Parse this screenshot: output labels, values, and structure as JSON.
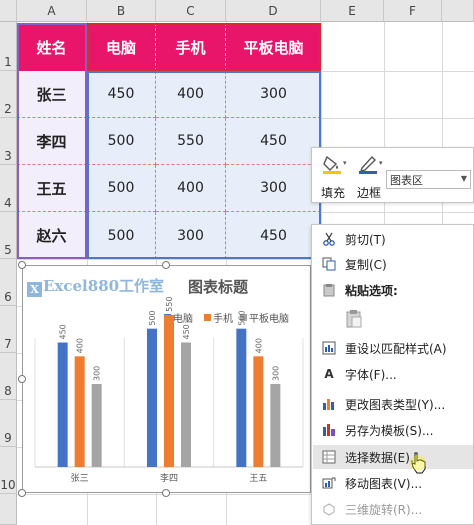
{
  "columns": [
    "A",
    "B",
    "C",
    "D",
    "E",
    "F"
  ],
  "rows": [
    "1",
    "2",
    "3",
    "4",
    "5",
    "6",
    "7",
    "8",
    "9",
    "10"
  ],
  "table": {
    "headers": [
      "姓名",
      "电脑",
      "手机",
      "平板电脑"
    ],
    "rows": [
      {
        "name": "张三",
        "values": [
          "450",
          "400",
          "300"
        ]
      },
      {
        "name": "李四",
        "values": [
          "500",
          "550",
          "450"
        ]
      },
      {
        "name": "王五",
        "values": [
          "500",
          "400",
          "300"
        ]
      },
      {
        "name": "赵六",
        "values": [
          "500",
          "300",
          "450"
        ]
      }
    ]
  },
  "chart": {
    "watermark": "Excel880工作室",
    "watermark_icon": "x-logo-icon"
  },
  "chart_data": {
    "type": "bar",
    "title": "图表标题",
    "categories": [
      "张三",
      "李四",
      "王五"
    ],
    "series": [
      {
        "name": "电脑",
        "values": [
          450,
          500,
          500
        ],
        "color": "#4472c4"
      },
      {
        "name": "手机",
        "values": [
          400,
          550,
          400
        ],
        "color": "#ed7d31"
      },
      {
        "name": "平板电脑",
        "values": [
          300,
          450,
          300
        ],
        "color": "#a5a5a5"
      }
    ],
    "ylim": [
      0,
      600
    ],
    "legend": "top",
    "data_labels": true,
    "grid": true
  },
  "mini_toolbar": {
    "fill_label": "填充",
    "border_label": "边框",
    "element_select": "图表区",
    "fill_icon": "paint-bucket-icon",
    "border_icon": "pen-border-icon"
  },
  "context_menu": {
    "items": [
      {
        "label": "剪切(T)",
        "icon": "scissors-icon"
      },
      {
        "label": "复制(C)",
        "icon": "copy-icon"
      },
      {
        "label": "粘贴选项:",
        "icon": "clipboard-icon"
      },
      {
        "label": "",
        "icon": "paste-icon"
      },
      {
        "label": "重设以匹配样式(A)",
        "icon": "reset-style-icon"
      },
      {
        "label": "字体(F)...",
        "icon": "font-icon"
      },
      {
        "label": "更改图表类型(Y)...",
        "icon": "chart-type-icon"
      },
      {
        "label": "另存为模板(S)...",
        "icon": "save-template-icon"
      },
      {
        "label": "选择数据(E)...",
        "icon": "select-data-icon"
      },
      {
        "label": "移动图表(V)...",
        "icon": "move-chart-icon"
      },
      {
        "label": "三维旋转(R)...",
        "icon": "rotate-3d-icon"
      }
    ]
  }
}
